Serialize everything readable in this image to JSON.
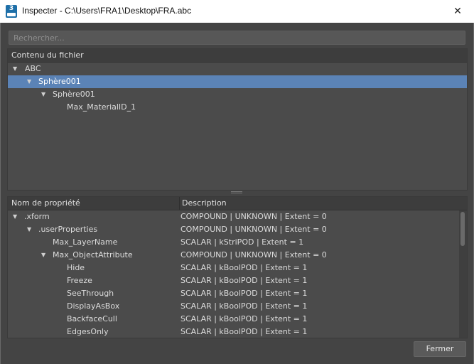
{
  "window": {
    "title": "Inspecter - C:\\Users\\FRA1\\Desktop\\FRA.abc",
    "app_icon_text": "3",
    "close_glyph": "✕"
  },
  "search": {
    "placeholder": "Rechercher..."
  },
  "contents_panel": {
    "header": "Contenu du fichier",
    "items": [
      {
        "label": "ABC",
        "expanded": true,
        "selected": false
      },
      {
        "label": "Sphère001",
        "expanded": true,
        "selected": true
      },
      {
        "label": "Sphère001",
        "expanded": true,
        "selected": false
      },
      {
        "label": "Max_MaterialID_1",
        "expanded": false,
        "selected": false
      }
    ]
  },
  "properties_panel": {
    "columns": [
      "Nom de propriété",
      "Description"
    ],
    "rows": [
      {
        "name": ".xform",
        "description": "COMPOUND | UNKNOWN | Extent = 0",
        "expanded": true
      },
      {
        "name": ".userProperties",
        "description": "COMPOUND | UNKNOWN | Extent = 0",
        "expanded": true
      },
      {
        "name": "Max_LayerName",
        "description": "SCALAR | kStriPOD | Extent = 1"
      },
      {
        "name": "Max_ObjectAttribute",
        "description": "COMPOUND | UNKNOWN | Extent = 0",
        "expanded": true
      },
      {
        "name": "Hide",
        "description": "SCALAR | kBoolPOD | Extent = 1"
      },
      {
        "name": "Freeze",
        "description": "SCALAR | kBoolPOD | Extent = 1"
      },
      {
        "name": "SeeThrough",
        "description": "SCALAR | kBoolPOD | Extent = 1"
      },
      {
        "name": "DisplayAsBox",
        "description": "SCALAR | kBoolPOD | Extent = 1"
      },
      {
        "name": "BackfaceCull",
        "description": "SCALAR | kBoolPOD | Extent = 1"
      },
      {
        "name": "EdgesOnly",
        "description": "SCALAR | kBoolPOD | Extent = 1"
      }
    ]
  },
  "footer": {
    "close_label": "Fermer"
  },
  "colors": {
    "background": "#444444",
    "selection": "#5b83b6",
    "header": "#3d3d3d"
  }
}
